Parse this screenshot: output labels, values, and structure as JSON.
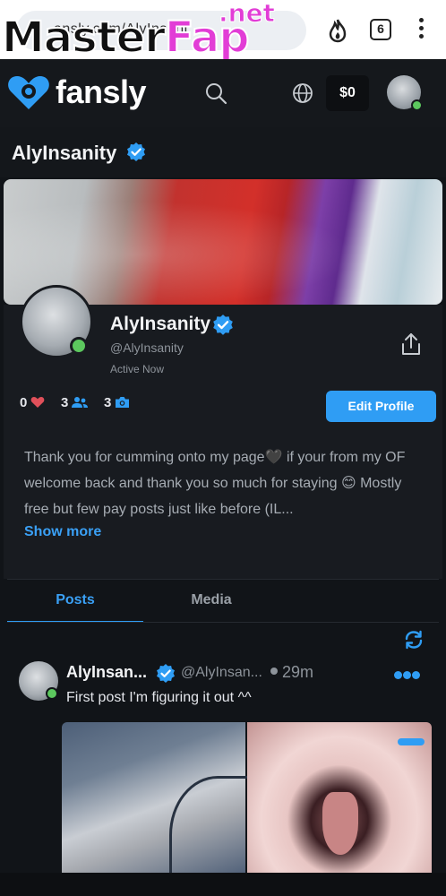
{
  "browser": {
    "url_fragment": "ansly.com/AlyInsani",
    "tab_count": "6",
    "watermark_main": "Master",
    "watermark_accent": "Fap",
    "watermark_suffix": ".net"
  },
  "appbar": {
    "logo_text": "fansly",
    "wallet_balance": "$0"
  },
  "profile": {
    "title": "AlyInsanity",
    "display_name": "AlyInsanity",
    "handle": "@AlyInsanity",
    "status": "Active Now",
    "likes_count": "0",
    "followers_count": "3",
    "media_count": "3",
    "edit_button_label": "Edit Profile",
    "bio": "Thank you for cumming onto my page🖤 if your from my OF welcome back and thank you so much for staying 😊 Mostly free but few pay posts just like before (IL...",
    "show_more_label": "Show more"
  },
  "tabs": [
    {
      "label": "Posts",
      "active": true
    },
    {
      "label": "Media",
      "active": false
    }
  ],
  "post": {
    "author_name": "AlyInsan...",
    "author_handle": "@AlyInsan...",
    "time_ago": "29m",
    "text": "First post I'm figuring it out ^^"
  },
  "colors": {
    "accent": "#2f9df4",
    "background": "#111418",
    "online": "#5cc85e",
    "heart": "#e0505a"
  }
}
